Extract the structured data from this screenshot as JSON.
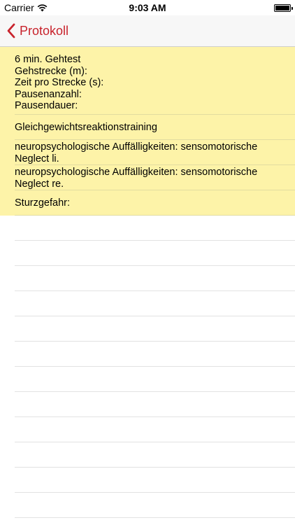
{
  "status_bar": {
    "carrier": "Carrier",
    "time": "9:03 AM"
  },
  "nav": {
    "back_label": "Protokoll"
  },
  "rows": [
    {
      "lines": [
        "6 min. Gehtest",
        "Gehstrecke (m):",
        "Zeit pro Strecke (s):",
        "Pausenanzahl:",
        "Pausendauer:"
      ]
    },
    {
      "lines": [
        "Gleichgewichtsreaktionstraining"
      ]
    },
    {
      "lines": [
        "neuropsychologische Auffälligkeiten: sensomotorische",
        "Neglect li."
      ]
    },
    {
      "lines": [
        "neuropsychologische Auffälligkeiten: sensomotorische",
        "Neglect re."
      ]
    },
    {
      "lines": [
        "Sturzgefahr:"
      ]
    }
  ],
  "colors": {
    "accent": "#c8232c",
    "highlight": "#fdf3a8"
  }
}
